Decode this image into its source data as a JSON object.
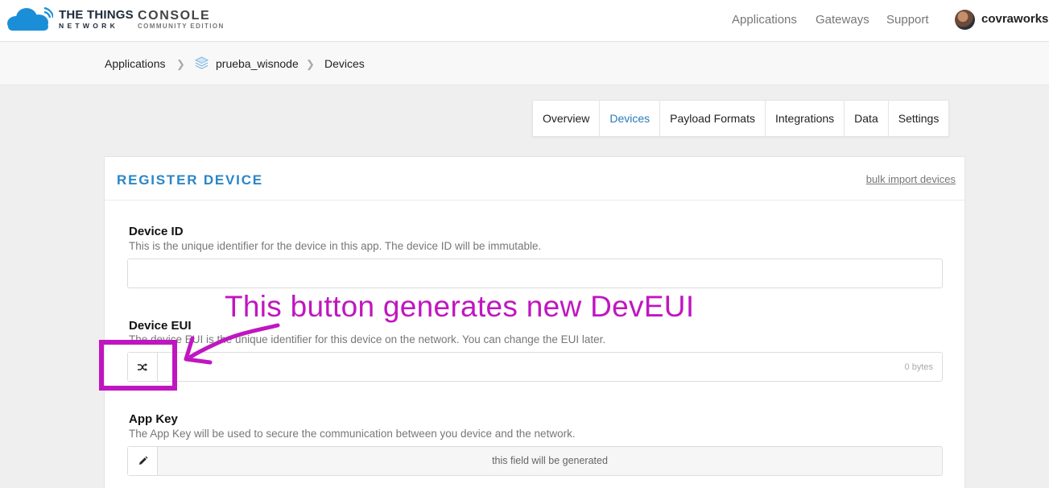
{
  "header": {
    "brand_top": "THE THINGS",
    "brand_bottom": "NETWORK",
    "console_top": "CONSOLE",
    "console_bottom": "COMMUNITY EDITION",
    "nav": [
      "Applications",
      "Gateways",
      "Support"
    ],
    "username": "covraworks"
  },
  "breadcrumb": {
    "items": [
      "Applications",
      "prueba_wisnode",
      "Devices"
    ]
  },
  "tabs": [
    {
      "label": "Overview",
      "active": false
    },
    {
      "label": "Devices",
      "active": true
    },
    {
      "label": "Payload Formats",
      "active": false
    },
    {
      "label": "Integrations",
      "active": false
    },
    {
      "label": "Data",
      "active": false
    },
    {
      "label": "Settings",
      "active": false
    }
  ],
  "card": {
    "title": "REGISTER DEVICE",
    "bulk_link": "bulk import devices",
    "fields": [
      {
        "label": "Device ID",
        "help": "This is the unique identifier for the device in this app. The device ID will be immutable.",
        "value": ""
      },
      {
        "label": "Device EUI",
        "help": "The device EUI is the unique identifier for this device on the network. You can change the EUI later.",
        "counter": "0 bytes",
        "icon": "shuffle-icon"
      },
      {
        "label": "App Key",
        "help": "The App Key will be used to secure the communication between you device and the network.",
        "placeholder": "this field will be generated",
        "icon": "pencil-icon"
      }
    ]
  },
  "annotation": {
    "text": "This button generates new DevEUI",
    "color": "#c016c0"
  },
  "colors": {
    "accent": "#2a86c6",
    "annotation": "#c016c0"
  }
}
